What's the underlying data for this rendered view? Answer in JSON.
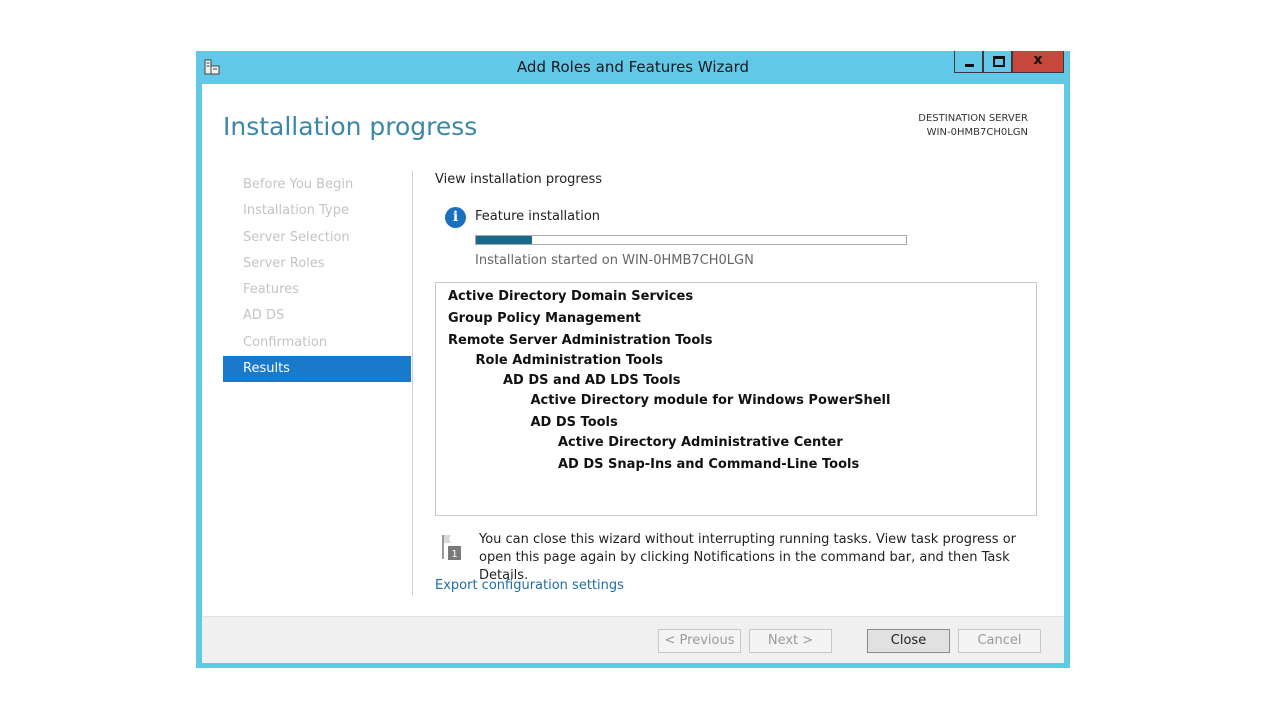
{
  "window": {
    "title": "Add Roles and Features Wizard",
    "controls": {
      "minimize": "minimize",
      "maximize": "maximize",
      "close": "x"
    }
  },
  "header": {
    "page_title": "Installation progress",
    "destination_label": "DESTINATION SERVER",
    "destination_server": "WIN-0HMB7CH0LGN"
  },
  "steps": [
    {
      "label": "Before You Begin",
      "active": false
    },
    {
      "label": "Installation Type",
      "active": false
    },
    {
      "label": "Server Selection",
      "active": false
    },
    {
      "label": "Server Roles",
      "active": false
    },
    {
      "label": "Features",
      "active": false
    },
    {
      "label": "AD DS",
      "active": false
    },
    {
      "label": "Confirmation",
      "active": false
    },
    {
      "label": "Results",
      "active": true
    }
  ],
  "content": {
    "view_label": "View installation progress",
    "feature_label": "Feature installation",
    "progress_fraction": 0.13,
    "started_text": "Installation started on WIN-0HMB7CH0LGN",
    "results": [
      {
        "text": "Active Directory Domain Services",
        "level": 0
      },
      {
        "text": "Group Policy Management",
        "level": 0
      },
      {
        "text": "Remote Server Administration Tools",
        "level": 0
      },
      {
        "text": "Role Administration Tools",
        "level": 1
      },
      {
        "text": "AD DS and AD LDS Tools",
        "level": 2
      },
      {
        "text": "Active Directory module for Windows PowerShell",
        "level": 3
      },
      {
        "text": "AD DS Tools",
        "level": 3
      },
      {
        "text": "Active Directory Administrative Center",
        "level": 4
      },
      {
        "text": "AD DS Snap-Ins and Command-Line Tools",
        "level": 4
      }
    ],
    "flag_number": "1",
    "note": "You can close this wizard without interrupting running tasks. View task progress or open this page again by clicking Notifications in the command bar, and then Task Details.",
    "export_link": "Export configuration settings"
  },
  "footer": {
    "previous": "< Previous",
    "next": "Next >",
    "close": "Close",
    "cancel": "Cancel"
  },
  "colors": {
    "frame": "#62c8e8",
    "title_text": "#3b88a6",
    "active_step": "#1979ca",
    "progress": "#176a8e",
    "link": "#1d6ea6",
    "close_button": "#c7473d"
  },
  "icons": {
    "app": "server-manager-icon",
    "info": "info-icon",
    "flag": "notification-flag-icon"
  }
}
